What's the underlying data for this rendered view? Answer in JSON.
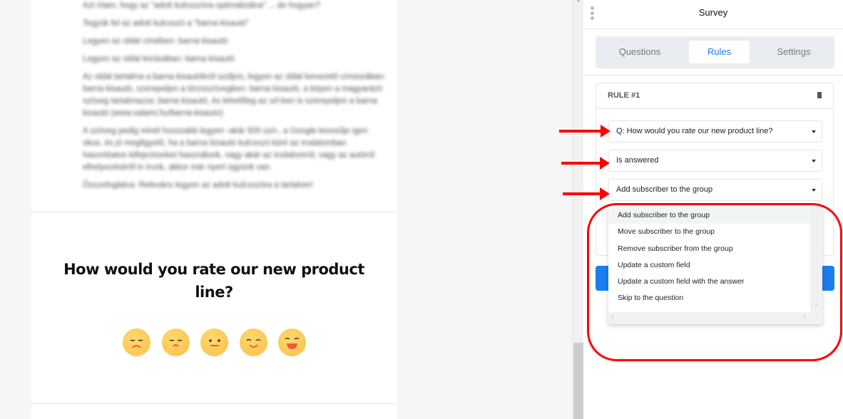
{
  "article": {
    "paragraphs": [
      "Azt írtam, hogy az \"adott kulcsszóra optimalizálva\" ... de hogyan?",
      "Tegyük fel az adott kulcsszó a \"barna kisautó\"",
      "Legyen az oldal címében: barna kisautó",
      "Legyen az oldal leírásában: barna kisautó",
      "Az oldal tartalma a barna kisautókról szóljon, legyen az oldal bevezető címsorában: barna kisautó, szerepeljen a törzsszövegben: barna kisautó, a képen a magyarázó szöveg tartalmazza: barna kisautó, és lehetőleg az url-ben is szerepeljen a barna kisautó (www.valami.hu/barna-kisauto)",
      "A szöveg pedig minél hosszabb legyen -akár 500 szó-, a Google keresője igen okos, és jó megfigyelő, ha a barna kisautó kulcsszó köré az irodalomban hasonlóatos kifejezéseket használunk, vagy akár az irodalomról, vagy az autóról elhelyezéséről is írunk, akkor már nyert ügyünk van.",
      "Összefoglalva: Releváns legyen az adott kulcsszóra a tartalom!"
    ]
  },
  "question": {
    "title": "How would you rate our new product line?",
    "rating_icons": [
      "very-sad-face-icon",
      "sad-face-icon",
      "neutral-face-icon",
      "smiling-face-icon",
      "laughing-face-icon"
    ]
  },
  "panel": {
    "title": "Survey",
    "tabs": [
      {
        "label": "Questions",
        "active": false
      },
      {
        "label": "Rules",
        "active": true
      },
      {
        "label": "Settings",
        "active": false
      }
    ],
    "rule": {
      "heading": "RULE #1",
      "question_select": "Q: How would you rate our new product line?",
      "condition_select": "Is answered",
      "action_select": "Add subscriber to the group"
    },
    "action_options": [
      "Add subscriber to the group",
      "Move subscriber to the group",
      "Remove subscriber from the group",
      "Update a custom field",
      "Update a custom field with the answer",
      "Skip to the question"
    ],
    "highlighted_option": "Add subscriber to the group"
  },
  "colors": {
    "accent": "#1a7cf0",
    "annotation": "#ff0000",
    "emoji": "#fbbf4c"
  }
}
